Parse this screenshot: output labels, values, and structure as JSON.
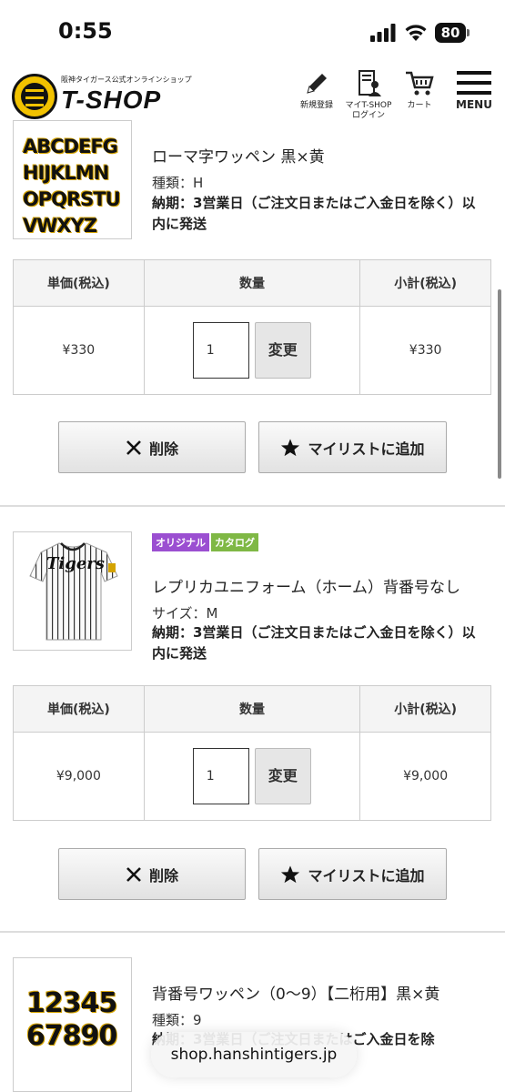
{
  "status_bar": {
    "time": "0:55",
    "battery": "80"
  },
  "header": {
    "logo_subtitle": "阪神タイガース公式オンラインショップ",
    "logo_text": "T-SHOP",
    "register_label": "新規登録",
    "myshop_label_1": "マイT-SHOP",
    "myshop_label_2": "ログイン",
    "cart_label": "カート",
    "menu_label": "MENU"
  },
  "table_headers": {
    "unit_price": "単価(税込)",
    "quantity": "数量",
    "subtotal": "小計(税込)"
  },
  "buttons": {
    "change": "変更",
    "delete": "削除",
    "add_mylist": "マイリストに追加"
  },
  "items": [
    {
      "name": "ローマ字ワッペン 黒×黄",
      "attr": "種類：H",
      "delivery": "納期：3営業日（ご注文日またはご入金日を除く）以内に発送",
      "thumb_lines": [
        "ABCDEFG",
        "HIJKLMN",
        "OPQRSTU",
        "VWXYZ"
      ],
      "unit_price": "¥330",
      "quantity": "1",
      "subtotal": "¥330"
    },
    {
      "tags": [
        "オリジナル",
        "カタログ"
      ],
      "name": "レプリカユニフォーム（ホーム）背番号なし",
      "attr": "サイズ：M",
      "delivery": "納期：3営業日（ご注文日またはご入金日を除く）以内に発送",
      "jersey_text": "Tigers",
      "unit_price": "¥9,000",
      "quantity": "1",
      "subtotal": "¥9,000"
    },
    {
      "name": "背番号ワッペン（0〜9）【二桁用】黒×黄",
      "attr": "種類：9",
      "delivery": "納期：3営業日（ご注文日またはご入金日を除",
      "thumb_lines": [
        "12345",
        "67890"
      ]
    }
  ],
  "url_bar": "shop.hanshintigers.jp",
  "colors": {
    "tag_original": "#9b4fd1",
    "tag_catalog": "#7fb845",
    "patch_yellow": "#d4a300"
  }
}
